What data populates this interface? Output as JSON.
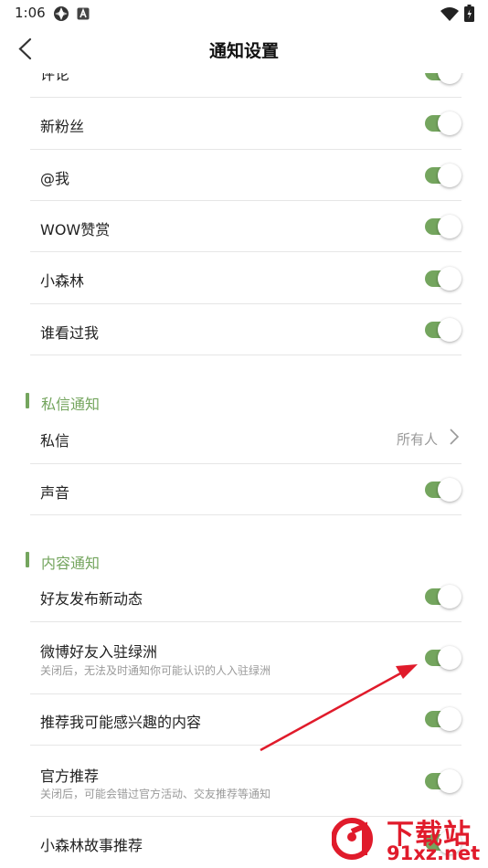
{
  "status_bar": {
    "time": "1:06",
    "icons": [
      "app-logo-icon",
      "a-badge-icon",
      "wifi-icon",
      "battery-icon"
    ]
  },
  "header": {
    "title": "通知设置",
    "back_icon": "chevron-left-icon"
  },
  "top_rows": [
    {
      "label": "评论",
      "toggle": "on"
    },
    {
      "label": "新粉丝",
      "toggle": "on"
    },
    {
      "label": "@我",
      "toggle": "on"
    },
    {
      "label": "WOW赞赏",
      "toggle": "on"
    },
    {
      "label": "小森林",
      "toggle": "on"
    },
    {
      "label": "谁看过我",
      "toggle": "on"
    }
  ],
  "sections": {
    "private": {
      "title": "私信通知",
      "rows": {
        "dm": {
          "label": "私信",
          "value": "所有人"
        },
        "sound": {
          "label": "声音",
          "toggle": "on"
        }
      }
    },
    "content": {
      "title": "内容通知",
      "rows": [
        {
          "label": "好友发布新动态",
          "toggle": "on"
        },
        {
          "label": "微博好友入驻绿洲",
          "subtitle": "关闭后，无法及时通知你可能认识的人入驻绿洲",
          "toggle": "on"
        },
        {
          "label": "推荐我可能感兴趣的内容",
          "toggle": "on"
        },
        {
          "label": "官方推荐",
          "subtitle": "关闭后，可能会错过官方活动、交友推荐等通知",
          "toggle": "on"
        },
        {
          "label": "小森林故事推荐",
          "toggle": "on"
        }
      ]
    }
  },
  "watermark": {
    "top": "下载站",
    "bottom": "91xz.net"
  },
  "colors": {
    "accent": "#74a55e",
    "annotation_arrow": "#e01b2b"
  }
}
